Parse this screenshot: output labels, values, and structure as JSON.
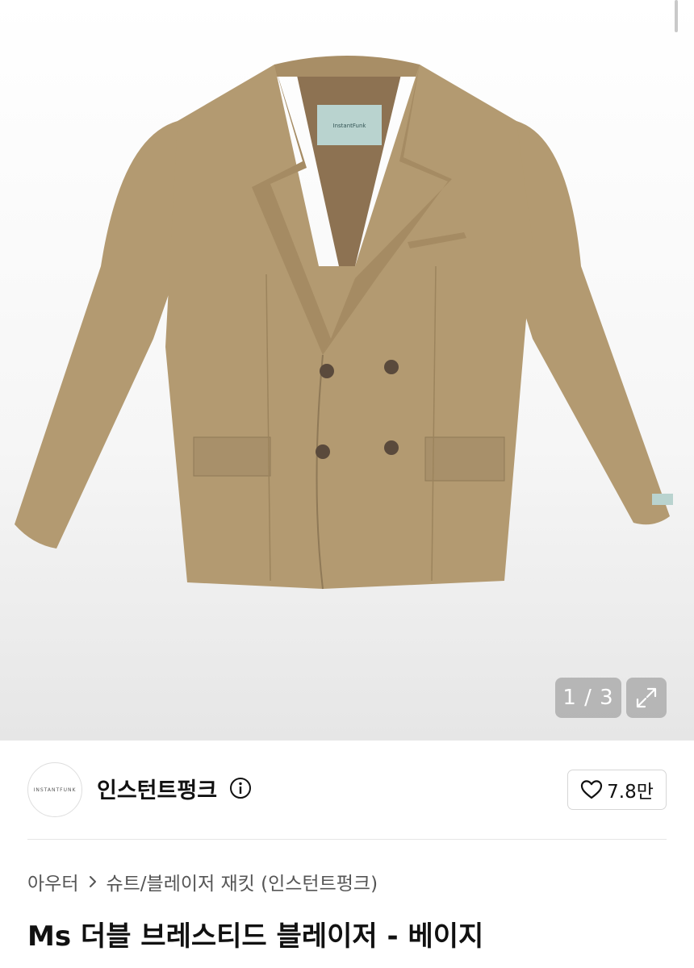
{
  "gallery": {
    "counter": "1 / 3",
    "image_alt": "InstantFunk double-breasted beige blazer",
    "label_text": "InstantFunk"
  },
  "brand": {
    "name": "인스턴트펑크",
    "avatar_text": "INSTANTFUNK"
  },
  "likes": {
    "count": "7.8만"
  },
  "breadcrumb": {
    "category": "아우터",
    "subcategory": "슈트/블레이저 재킷 (인스턴트펑크)"
  },
  "product": {
    "title": "Ms 더블 브레스티드 블레이저 - 베이지"
  },
  "colors": {
    "jacket": "#b39a71",
    "lining": "#8d7252",
    "label": "#b9d3cf"
  }
}
